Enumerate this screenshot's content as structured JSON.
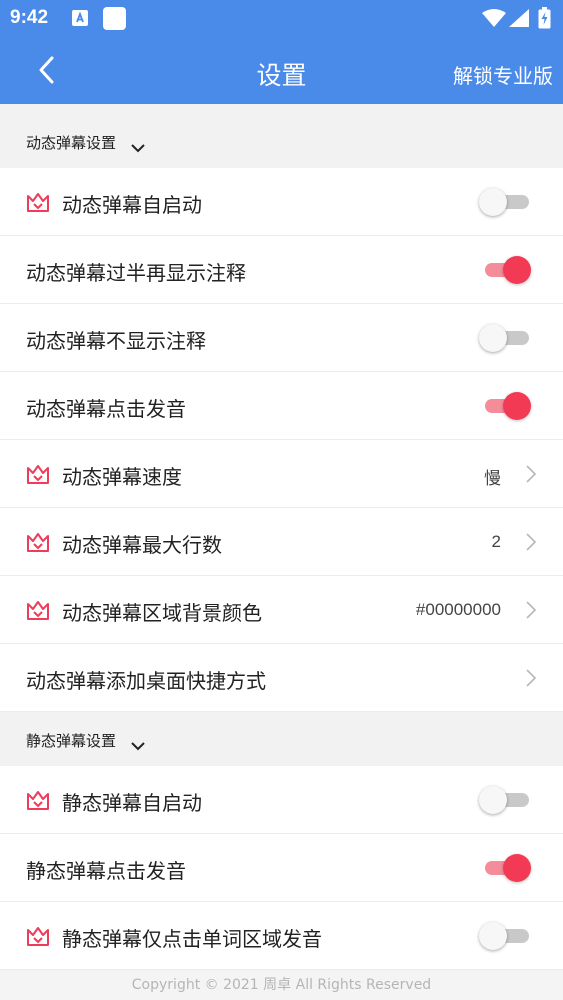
{
  "status_bar": {
    "time": "9:42"
  },
  "app_bar": {
    "title": "设置",
    "action": "解锁专业版"
  },
  "colors": {
    "primary": "#4a8bea",
    "toggle_on": "#f23a55",
    "crown": "#ee3c5a"
  },
  "dynamic_section": {
    "header": "动态弹幕设置",
    "rows": [
      {
        "label": "动态弹幕自启动",
        "pro": true,
        "toggle": false
      },
      {
        "label": "动态弹幕过半再显示注释",
        "pro": false,
        "toggle": true
      },
      {
        "label": "动态弹幕不显示注释",
        "pro": false,
        "toggle": false
      },
      {
        "label": "动态弹幕点击发音",
        "pro": false,
        "toggle": true
      },
      {
        "label": "动态弹幕速度",
        "pro": true,
        "value": "慢"
      },
      {
        "label": "动态弹幕最大行数",
        "pro": true,
        "value": "2"
      },
      {
        "label": "动态弹幕区域背景颜色",
        "pro": true,
        "value": "#00000000"
      },
      {
        "label": "动态弹幕添加桌面快捷方式",
        "pro": false,
        "value": ""
      }
    ]
  },
  "static_section": {
    "header": "静态弹幕设置",
    "rows": [
      {
        "label": "静态弹幕自启动",
        "pro": true,
        "toggle": false
      },
      {
        "label": "静态弹幕点击发音",
        "pro": false,
        "toggle": true
      },
      {
        "label": "静态弹幕仅点击单词区域发音",
        "pro": true,
        "toggle": false
      }
    ]
  },
  "footer": {
    "text": "Copyright © 2021 周卓 All Rights Reserved"
  }
}
